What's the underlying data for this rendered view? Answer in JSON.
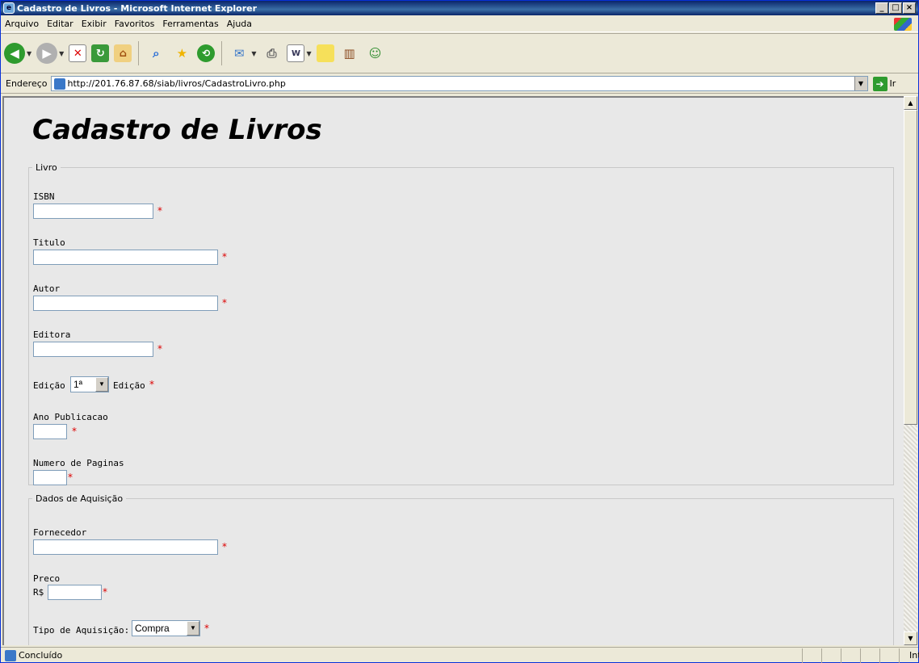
{
  "window": {
    "title": "Cadastro de Livros - Microsoft Internet Explorer"
  },
  "menu": [
    "Arquivo",
    "Editar",
    "Exibir",
    "Favoritos",
    "Ferramentas",
    "Ajuda"
  ],
  "address": {
    "label": "Endereço",
    "url": "http://201.76.87.68/siab/livros/CadastroLivro.php",
    "go_label": "Ir"
  },
  "page": {
    "heading": "Cadastro de Livros",
    "livro": {
      "legend": "Livro",
      "isbn_label": "ISBN",
      "titulo_label": "Titulo",
      "autor_label": "Autor",
      "editora_label": "Editora",
      "edicao_label": "Edição",
      "edicao_value": "1ª",
      "edicao_suffix": "Edição",
      "ano_label": "Ano Publicacao",
      "paginas_label": "Numero de Paginas"
    },
    "aquisicao": {
      "legend": "Dados de Aquisição",
      "fornecedor_label": "Fornecedor",
      "preco_label": "Preco",
      "preco_prefix": "R$",
      "tipo_label": "Tipo de Aquisição:",
      "tipo_value": "Compra"
    },
    "required_mark": "*"
  },
  "status": {
    "text": "Concluído",
    "zone": "Internet"
  }
}
